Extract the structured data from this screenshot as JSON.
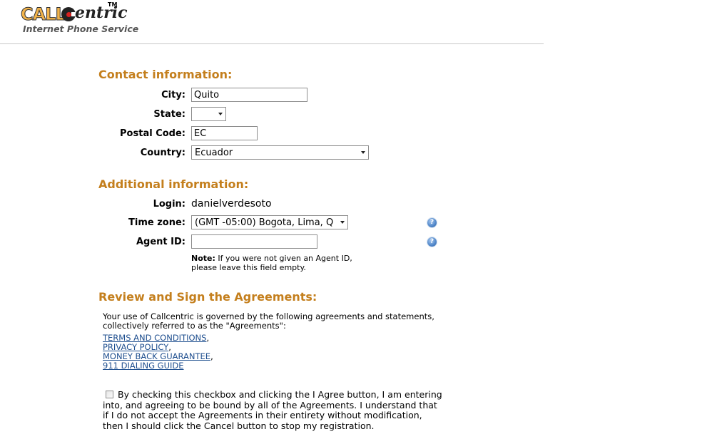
{
  "header": {
    "logo": {
      "call": "CALL",
      "entric": "entric",
      "tm": "TM"
    },
    "tagline": "Internet Phone Service"
  },
  "contact": {
    "title": "Contact information:",
    "city": {
      "label": "City:",
      "value": "Quito"
    },
    "state": {
      "label": "State:",
      "value": ""
    },
    "postal_code": {
      "label": "Postal Code:",
      "value": "EC"
    },
    "country": {
      "label": "Country:",
      "value": "Ecuador"
    }
  },
  "additional": {
    "title": "Additional information:",
    "login": {
      "label": "Login:",
      "value": "danielverdesoto"
    },
    "time_zone": {
      "label": "Time zone:",
      "value": "(GMT -05:00) Bogota, Lima, Q"
    },
    "agent_id": {
      "label": "Agent ID:",
      "value": ""
    },
    "help_icon_glyph": "?",
    "note_bold": "Note:",
    "note_text": " If you were not given an Agent ID, please leave this field empty."
  },
  "agreements": {
    "title": "Review and Sign the Agreements:",
    "intro": "Your use of Callcentric is governed by the following agreements and statements, collectively referred to as the \"Agreements\":",
    "links": [
      {
        "label": "TERMS AND CONDITIONS",
        "suffix": ","
      },
      {
        "label": "PRIVACY POLICY",
        "suffix": ","
      },
      {
        "label": "MONEY BACK GUARANTEE",
        "suffix": ","
      },
      {
        "label": "911 DIALING GUIDE",
        "suffix": ""
      }
    ],
    "consent_text": "By checking this checkbox and clicking the I Agree button, I am entering into, and agreeing to be bound by all of the Agreements. I understand that if I do not accept the Agreements in their entirety without modification, then I should click the Cancel button to stop my registration.",
    "consent_checked": false
  },
  "colors": {
    "section_title": "#c47f1d",
    "link": "#1f4f8f"
  }
}
